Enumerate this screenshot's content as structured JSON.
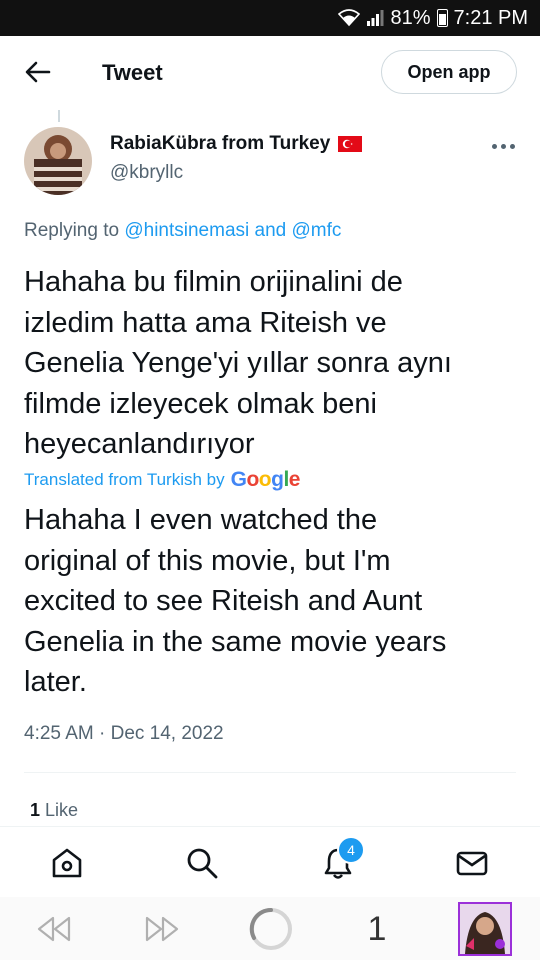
{
  "status_bar": {
    "battery": "81%",
    "time": "7:21 PM"
  },
  "header": {
    "title": "Tweet",
    "open_app": "Open app"
  },
  "author": {
    "name": "RabiaKübra from Turkey",
    "handle": "@kbryllc"
  },
  "replying": {
    "prefix": "Replying to",
    "users": "@hintsinemasi and @mfc"
  },
  "tweet": {
    "original_lines": [
      "Hahaha bu filmin orijinalini de",
      "izledim hatta ama Riteish ve",
      "Genelia Yenge'yi yıllar sonra aynı",
      "filmde izleyecek olmak beni",
      "heyecanlandırıyor"
    ],
    "translated_from": "Translated from Turkish by",
    "google": "Google",
    "translation_lines": [
      "Hahaha I even watched the",
      "original of this movie, but I'm",
      "excited to see Riteish and Aunt",
      "Genelia in the same movie years",
      "later."
    ],
    "timestamp": "4:25 AM · Dec 14, 2022"
  },
  "stats": {
    "like_count": "1",
    "like_label": "Like"
  },
  "tabbar": {
    "notification_count": "4"
  },
  "browser": {
    "tab_count": "1"
  },
  "colors": {
    "accent": "#1d9bf0",
    "secondary_text": "#536471",
    "flag_red": "#e30a17",
    "profile_border": "#9b30d9"
  },
  "icons": [
    "back-arrow-icon",
    "more-icon",
    "flag-turkey-icon",
    "home-icon",
    "search-icon",
    "bell-icon",
    "mail-icon",
    "rewind-icon",
    "forward-icon",
    "loading-icon"
  ]
}
